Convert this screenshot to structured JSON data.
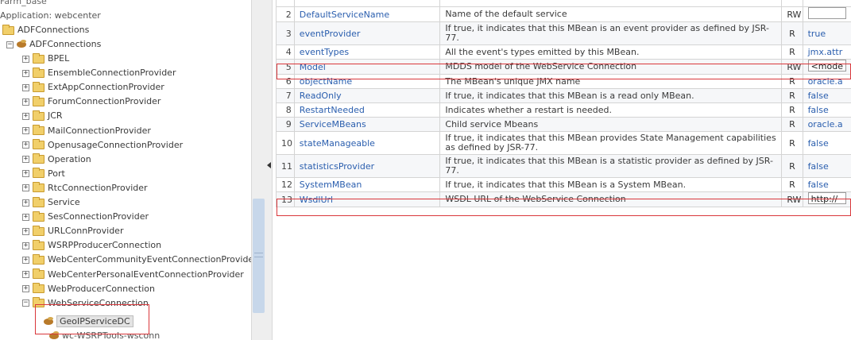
{
  "tree": {
    "cut_top_label": "Farm_base",
    "application_label": "Application: webcenter",
    "root": "ADFConnections",
    "child": "ADFConnections",
    "items": [
      "BPEL",
      "EnsembleConnectionProvider",
      "ExtAppConnectionProvider",
      "ForumConnectionProvider",
      "JCR",
      "MailConnectionProvider",
      "OpenusageConnectionProvider",
      "Operation",
      "Port",
      "RtcConnectionProvider",
      "Service",
      "SesConnectionProvider",
      "URLConnProvider",
      "WSRPProducerConnection",
      "WebCenterCommunityEventConnectionProvider",
      "WebCenterPersonalEventConnectionProvider",
      "WebProducerConnection",
      "WebServiceConnection"
    ],
    "selected_leaf": "GeoIPServiceDC",
    "partial_leaf": "wc-WSRPTools-wsconn"
  },
  "attributes": [
    {
      "num": "2",
      "name": "DefaultServiceName",
      "desc": "Name of the default service",
      "access": "RW",
      "value": "",
      "input": true
    },
    {
      "num": "3",
      "name": "eventProvider",
      "desc": "If true, it indicates that this MBean is an event provider as defined by JSR-77.",
      "access": "R",
      "value": "true"
    },
    {
      "num": "4",
      "name": "eventTypes",
      "desc": "All the event's types emitted by this MBean.",
      "access": "R",
      "value": "jmx.attr"
    },
    {
      "num": "5",
      "name": "Model",
      "desc": "MDDS model of the WebService Connection",
      "access": "RW",
      "value": "<mode",
      "input": true
    },
    {
      "num": "6",
      "name": "objectName",
      "desc": "The MBean's unique JMX name",
      "access": "R",
      "value": "oracle.a"
    },
    {
      "num": "7",
      "name": "ReadOnly",
      "desc": "If true, it indicates that this MBean is a read only MBean.",
      "access": "R",
      "value": "false"
    },
    {
      "num": "8",
      "name": "RestartNeeded",
      "desc": "Indicates whether a restart is needed.",
      "access": "R",
      "value": "false"
    },
    {
      "num": "9",
      "name": "ServiceMBeans",
      "desc": "Child service Mbeans",
      "access": "R",
      "value": "oracle.a"
    },
    {
      "num": "10",
      "name": "stateManageable",
      "desc": "If true, it indicates that this MBean provides State Management capabilities as defined by JSR-77.",
      "access": "R",
      "value": "false"
    },
    {
      "num": "11",
      "name": "statisticsProvider",
      "desc": "If true, it indicates that this MBean is a statistic provider as defined by JSR-77.",
      "access": "R",
      "value": "false"
    },
    {
      "num": "12",
      "name": "SystemMBean",
      "desc": "If true, it indicates that this MBean is a System MBean.",
      "access": "R",
      "value": "false"
    },
    {
      "num": "13",
      "name": "WsdlUrl",
      "desc": "WSDL URL of the WebService Connection",
      "access": "RW",
      "value": "http://",
      "input": true
    }
  ],
  "colors": {
    "highlight": "#d9373b",
    "link": "#2a5eae"
  }
}
